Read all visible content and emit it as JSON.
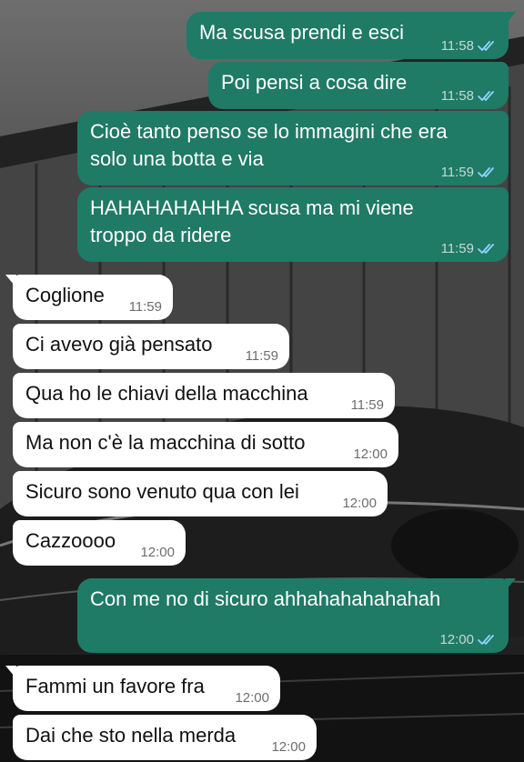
{
  "theme": {
    "outgoing_bubble": "#1f7a66",
    "incoming_bubble": "#ffffff",
    "read_ticks": "#8fd3ff"
  },
  "messages": [
    {
      "dir": "out",
      "text": [
        "Ma scusa prendi e esci"
      ],
      "time": "11:58",
      "read": true
    },
    {
      "dir": "out",
      "text": [
        "Poi pensi a cosa dire"
      ],
      "time": "11:58",
      "read": true
    },
    {
      "dir": "out",
      "text": [
        "Cioè tanto penso se lo immagini che era",
        "solo una botta e via"
      ],
      "time": "11:59",
      "read": true
    },
    {
      "dir": "out",
      "text": [
        "HAHAHAHAHHA scusa ma mi viene",
        "troppo da ridere"
      ],
      "time": "11:59",
      "read": true
    },
    {
      "dir": "in",
      "text": [
        "Coglione"
      ],
      "time": "11:59"
    },
    {
      "dir": "in",
      "text": [
        "Ci avevo già pensato"
      ],
      "time": "11:59"
    },
    {
      "dir": "in",
      "text": [
        "Qua ho le chiavi della macchina"
      ],
      "time": "11:59"
    },
    {
      "dir": "in",
      "text": [
        "Ma non c'è la macchina di sotto"
      ],
      "time": "12:00"
    },
    {
      "dir": "in",
      "text": [
        "Sicuro sono venuto qua con lei"
      ],
      "time": "12:00"
    },
    {
      "dir": "in",
      "text": [
        "Cazzoooo"
      ],
      "time": "12:00"
    },
    {
      "dir": "out",
      "text": [
        "Con me no di sicuro ahhahahahahahah"
      ],
      "time": "12:00",
      "read": true
    },
    {
      "dir": "in",
      "text": [
        "Fammi un favore fra"
      ],
      "time": "12:00"
    },
    {
      "dir": "in",
      "text": [
        "Dai che sto nella merda"
      ],
      "time": "12:00"
    }
  ]
}
